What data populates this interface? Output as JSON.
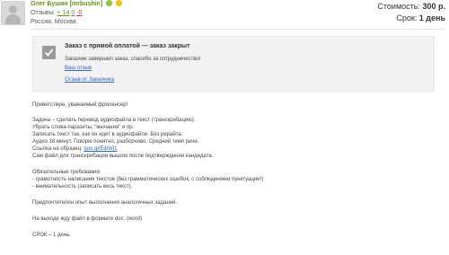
{
  "user": {
    "name": "Олег Бушин [mrbushin]",
    "reviews_label": "Отзывы:",
    "reviews_positive": "+ 14",
    "reviews_neutral": "0",
    "reviews_negative": "-0",
    "location": "Россия, Москва"
  },
  "order": {
    "price_label": "Стоимость:",
    "price_value": "300 р.",
    "term_label": "Срок:",
    "term_value": "1 день"
  },
  "notice": {
    "title": "Заказ с прямой оплатой — заказ закрыт",
    "text": "Заказчик завершил заказ, спасибо за сотрудничество!",
    "link_your_review": "Ваш отзыв",
    "link_client_review": "Отзыв от Заказчика"
  },
  "description": {
    "greeting": "Приветствую, уважаемый фрилансер!",
    "task_line1": "Задача – сделать перевод аудиофайла в текст (транскрибацию).",
    "task_line2": "Убрать слова-паразиты, \"мычания\" и пр.",
    "task_line3": "Записать текст так, как он идет в аудиофайле. Без рерайта.",
    "task_line4": "Аудио 18 минут. Говорю понятно, разборчиво. Средний темп речи.",
    "sample_label": "Ссылка на образец:",
    "sample_link": "goo.gl/EibWj1",
    "task_line6": "Сам файл для транскрибации вышлю после подтверждения кандидата.",
    "requirements_title": "Обязательные требования:",
    "req1": "- грамотность написания текстов (без грамматических ошибок, с соблюдением пунктуации!)",
    "req2": "- внимательность (записать весь текст).",
    "preferred": "Предпочтителен опыт выполнения аналогичных заданий.",
    "output_format": "На выходе жду файл в формате doc. (word)",
    "deadline": "СРОК – 1 день."
  }
}
